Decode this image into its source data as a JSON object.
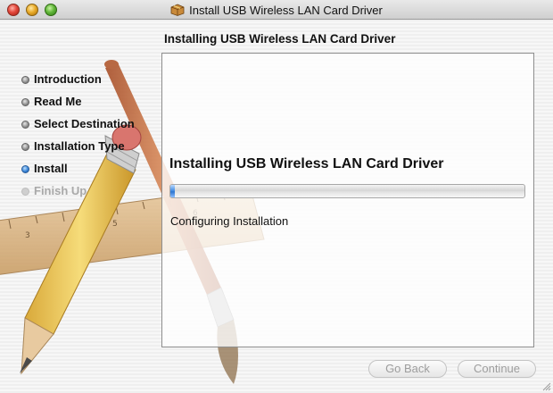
{
  "window": {
    "title": "Install USB Wireless LAN Card Driver",
    "traffic_lights": [
      "close",
      "minimize",
      "zoom"
    ],
    "title_icon": "package-icon"
  },
  "header": {
    "title": "Installing USB Wireless LAN Card Driver"
  },
  "steps": [
    {
      "label": "Introduction",
      "state": "done"
    },
    {
      "label": "Read Me",
      "state": "done"
    },
    {
      "label": "Select Destination",
      "state": "done"
    },
    {
      "label": "Installation Type",
      "state": "done"
    },
    {
      "label": "Install",
      "state": "active"
    },
    {
      "label": "Finish Up",
      "state": "pending"
    }
  ],
  "panel": {
    "title": "Installing USB Wireless LAN Card Driver",
    "progress_fraction": 0.012,
    "status": "Configuring Installation"
  },
  "buttons": {
    "go_back": "Go Back",
    "continue": "Continue"
  },
  "colors": {
    "accent_blue": "#3a86d8",
    "text_dark": "#111111",
    "text_disabled": "#a9a9a9"
  }
}
